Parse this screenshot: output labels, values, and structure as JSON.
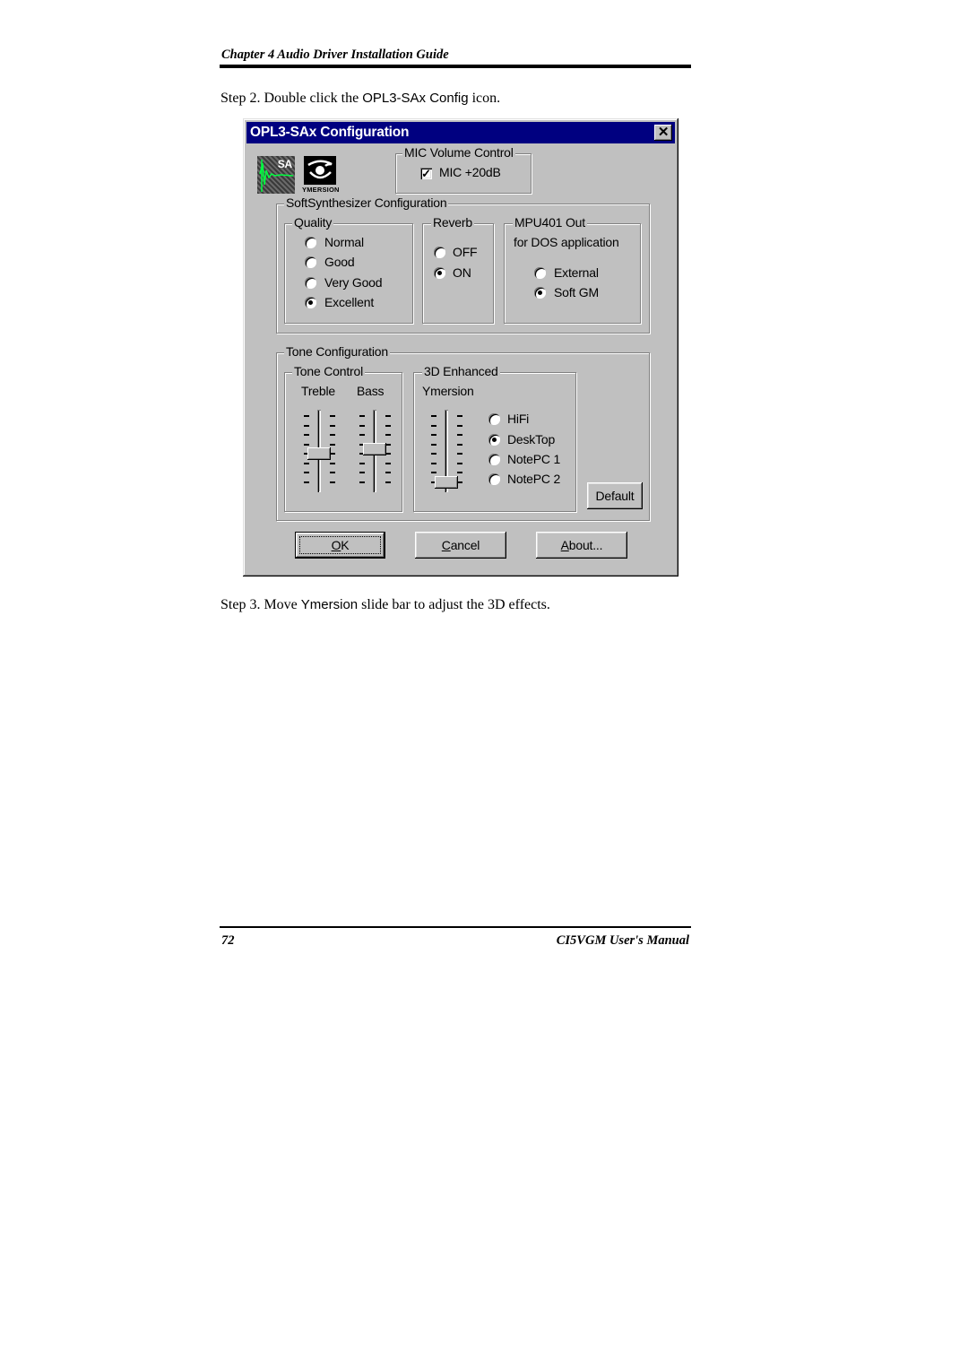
{
  "page": {
    "header": "Chapter 4  Audio Driver Installation Guide",
    "step2": {
      "prefix": "Step 2.  Double click the ",
      "app_name": "OPL3-SAx Config",
      "suffix": " icon."
    },
    "step3": {
      "prefix": "Step 3.  Move ",
      "control": "Ymersion",
      "suffix": " slide bar to adjust the 3D effects."
    },
    "footer": {
      "page_number": "72",
      "manual": "CI5VGM User's Manual"
    }
  },
  "dialog": {
    "title": "OPL3-SAx Configuration",
    "close_icon": "close-x",
    "logos": {
      "sa_logo": "SA",
      "ymersion_logo": "YMERSION"
    },
    "mic": {
      "group_label": "MIC Volume Control",
      "checkbox_label": "MIC +20dB",
      "checked": true
    },
    "softsynth": {
      "group_label": "SoftSynthesizer Configuration",
      "quality": {
        "label": "Quality",
        "options": [
          "Normal",
          "Good",
          "Very Good",
          "Excellent"
        ],
        "selected": "Excellent"
      },
      "reverb": {
        "label": "Reverb",
        "options": [
          "OFF",
          "ON"
        ],
        "selected": "ON"
      },
      "mpu401": {
        "label": "MPU401 Out",
        "sublabel": "for DOS application",
        "options": [
          "External",
          "Soft GM"
        ],
        "selected": "Soft GM"
      }
    },
    "tone": {
      "group_label": "Tone Configuration",
      "tone_control": {
        "label": "Tone Control",
        "treble": {
          "label": "Treble",
          "positions": 8,
          "value_index": 4
        },
        "bass": {
          "label": "Bass",
          "positions": 8,
          "value_index": 3.5
        }
      },
      "enhanced_3d": {
        "label": "3D Enhanced",
        "sublabel": "Ymersion",
        "ymersion": {
          "positions": 8,
          "value_index": 7
        },
        "options": [
          "HiFi",
          "DeskTop",
          "NotePC 1",
          "NotePC 2"
        ],
        "selected": "DeskTop"
      },
      "default_button": "Default"
    },
    "buttons": {
      "ok": {
        "accel": "O",
        "rest": "K"
      },
      "cancel": {
        "accel": "C",
        "rest": "ancel"
      },
      "about": {
        "accel": "A",
        "rest": "bout..."
      }
    }
  }
}
